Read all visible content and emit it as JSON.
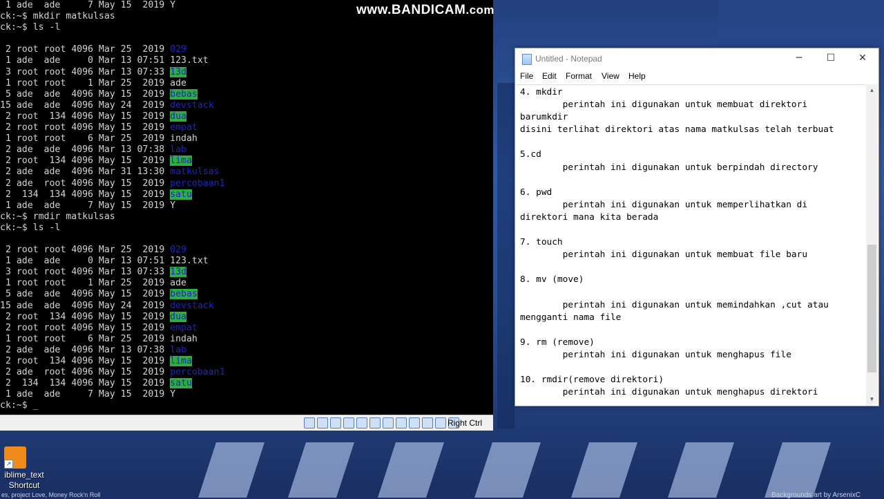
{
  "watermark": {
    "main": "www.BANDICAM",
    "suffix": ".com"
  },
  "terminal": {
    "lines": [
      [
        {
          "t": " 1 ade  ade     7 May 15  2019 Y"
        }
      ],
      [
        {
          "t": "ck:~$ mkdir matkulsas"
        }
      ],
      [
        {
          "t": "ck:~$ ls -l"
        }
      ],
      [
        {
          "t": ""
        }
      ],
      [
        {
          "t": " 2 root root 4096 Mar 25  2019 "
        },
        {
          "t": "029",
          "c": "blue"
        }
      ],
      [
        {
          "t": " 1 ade  ade     0 Mar 13 07:51 123.txt"
        }
      ],
      [
        {
          "t": " 3 root root 4096 Mar 13 07:33 "
        },
        {
          "t": "13d",
          "c": "green"
        }
      ],
      [
        {
          "t": " 1 root root    1 Mar 25  2019 ade"
        }
      ],
      [
        {
          "t": " 5 ade  ade  4096 May 15  2019 "
        },
        {
          "t": "bebas",
          "c": "green"
        }
      ],
      [
        {
          "t": "15 ade  ade  4096 May 24  2019 "
        },
        {
          "t": "devstack",
          "c": "blue"
        }
      ],
      [
        {
          "t": " 2 root  134 4096 May 15  2019 "
        },
        {
          "t": "dua",
          "c": "green"
        }
      ],
      [
        {
          "t": " 2 root root 4096 May 15  2019 "
        },
        {
          "t": "empat",
          "c": "blue"
        }
      ],
      [
        {
          "t": " 1 root root    6 Mar 25  2019 indah"
        }
      ],
      [
        {
          "t": " 2 ade  ade  4096 Mar 13 07:38 "
        },
        {
          "t": "lab",
          "c": "blue"
        }
      ],
      [
        {
          "t": " 2 root  134 4096 May 15  2019 "
        },
        {
          "t": "lima",
          "c": "green"
        }
      ],
      [
        {
          "t": " 2 ade  ade  4096 Mar 31 13:30 "
        },
        {
          "t": "matkulsas",
          "c": "blue"
        }
      ],
      [
        {
          "t": " 2 ade  root 4096 May 15  2019 "
        },
        {
          "t": "percobaan1",
          "c": "blue"
        }
      ],
      [
        {
          "t": " 2  134  134 4096 May 15  2019 "
        },
        {
          "t": "satu",
          "c": "green"
        }
      ],
      [
        {
          "t": " 1 ade  ade     7 May 15  2019 Y"
        }
      ],
      [
        {
          "t": "ck:~$ rmdir matkulsas"
        }
      ],
      [
        {
          "t": "ck:~$ ls -l"
        }
      ],
      [
        {
          "t": ""
        }
      ],
      [
        {
          "t": " 2 root root 4096 Mar 25  2019 "
        },
        {
          "t": "029",
          "c": "blue"
        }
      ],
      [
        {
          "t": " 1 ade  ade     0 Mar 13 07:51 123.txt"
        }
      ],
      [
        {
          "t": " 3 root root 4096 Mar 13 07:33 "
        },
        {
          "t": "13d",
          "c": "green"
        }
      ],
      [
        {
          "t": " 1 root root    1 Mar 25  2019 ade"
        }
      ],
      [
        {
          "t": " 5 ade  ade  4096 May 15  2019 "
        },
        {
          "t": "bebas",
          "c": "green"
        }
      ],
      [
        {
          "t": "15 ade  ade  4096 May 24  2019 "
        },
        {
          "t": "devstack",
          "c": "blue"
        }
      ],
      [
        {
          "t": " 2 root  134 4096 May 15  2019 "
        },
        {
          "t": "dua",
          "c": "green"
        }
      ],
      [
        {
          "t": " 2 root root 4096 May 15  2019 "
        },
        {
          "t": "empat",
          "c": "blue"
        }
      ],
      [
        {
          "t": " 1 root root    6 Mar 25  2019 indah"
        }
      ],
      [
        {
          "t": " 2 ade  ade  4096 Mar 13 07:38 "
        },
        {
          "t": "lab",
          "c": "blue"
        }
      ],
      [
        {
          "t": " 2 root  134 4096 May 15  2019 "
        },
        {
          "t": "lima",
          "c": "green"
        }
      ],
      [
        {
          "t": " 2 ade  root 4096 May 15  2019 "
        },
        {
          "t": "percobaan1",
          "c": "blue"
        }
      ],
      [
        {
          "t": " 2  134  134 4096 May 15  2019 "
        },
        {
          "t": "satu",
          "c": "green"
        }
      ],
      [
        {
          "t": " 1 ade  ade     7 May 15  2019 Y"
        }
      ],
      [
        {
          "t": "ck:~$ _"
        }
      ]
    ]
  },
  "vm_statusbar": {
    "host_key": "Right Ctrl"
  },
  "notepad": {
    "title": "Untitled - Notepad",
    "buttons": {
      "minimize": "─",
      "maximize": "☐",
      "close": "✕"
    },
    "menu": [
      "File",
      "Edit",
      "Format",
      "View",
      "Help"
    ],
    "content": "4. mkdir\n        perintah ini digunakan untuk membuat direktori\nbarumkdir\ndisini terlihat direktori atas nama matkulsas telah terbuat\n\n5.cd\n        perintah ini digunakan untuk berpindah directory\n\n6. pwd\n        perintah ini digunakan untuk memperlihatkan di\ndirektori mana kita berada\n\n7. touch\n        perintah ini digunakan untuk membuat file baru\n\n8. mv (move)\n\n        perintah ini digunakan untuk memindahkan ,cut atau\nmengganti nama file\n\n9. rm (remove)\n        perintah ini digunakan untuk menghapus file\n\n10. rmdir(remove direktori)\n        perintah ini digunakan untuk menghapus direktori"
  },
  "desktop_icon": {
    "label_line1": "iblime_text",
    "label_line2": "Shortcut",
    "icon": "sublime-text-icon"
  },
  "bottom_left_text": "es, project Love, Money Rock'n Roll",
  "bottom_right_text": "Backgrounds art by ArsenixC"
}
